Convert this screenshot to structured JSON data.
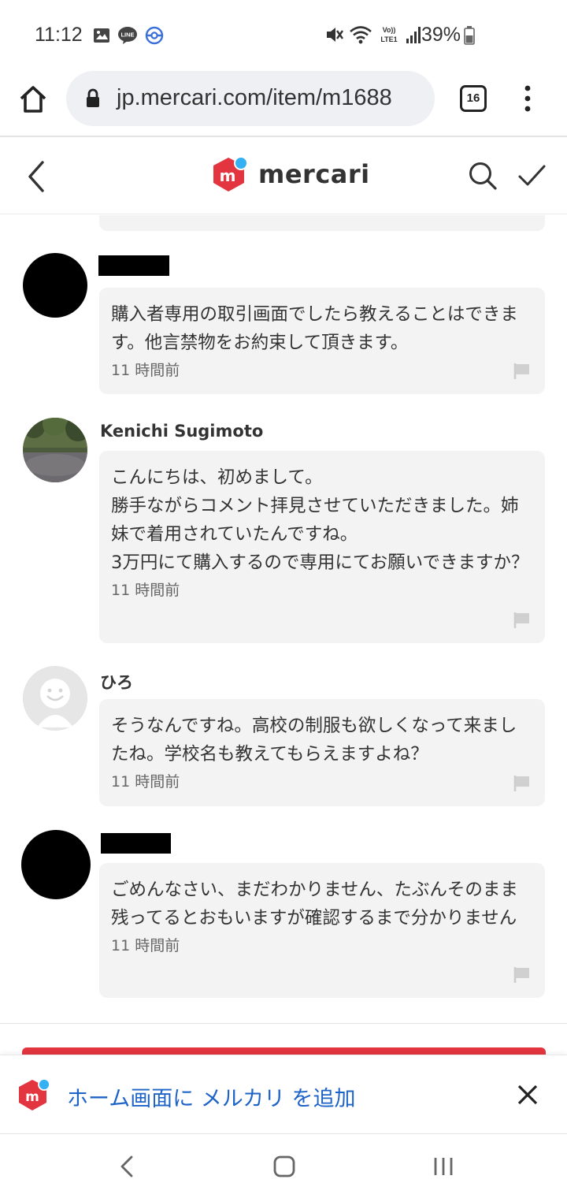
{
  "status_bar": {
    "time": "11:12",
    "battery": "39%",
    "left_icons": [
      "gallery-icon",
      "line-app-icon",
      "pokemon-go-icon"
    ],
    "right_icons": [
      "mute-icon",
      "wifi-icon",
      "volte-lte-icon",
      "signal-icon",
      "battery-icon"
    ],
    "volte_label": "Vo))\nLTE1"
  },
  "browser": {
    "url": "jp.mercari.com/item/m1688",
    "tab_count": "16"
  },
  "header": {
    "logo_text": "mercari",
    "brand_color": "#e3353f",
    "logo_dot_color": "#35b0f2"
  },
  "comments": [
    {
      "name": "",
      "name_redacted": true,
      "avatar": "redacted-black",
      "text": "購入者専用の取引画面でしたら教えることはできます。他言禁物をお約束して頂きます。",
      "time": "11 時間前"
    },
    {
      "name": "Kenichi Sugimoto",
      "name_redacted": false,
      "avatar": "photo-park",
      "text": "こんにちは、初めまして。\n勝手ながらコメント拝見させていただきました。姉妹で着用されていたんですね。\n3万円にて購入するので専用にてお願いできますか？",
      "time": "11 時間前"
    },
    {
      "name": "ひろ",
      "name_redacted": false,
      "avatar": "default-smiley",
      "text": "そうなんですね。高校の制服も欲しくなって来ましたね。学校名も教えてもらえますよね？",
      "time": "11 時間前"
    },
    {
      "name": "",
      "name_redacted": true,
      "avatar": "redacted-black",
      "text": "ごめんなさい、まだわかりません、たぶんそのまま残ってるとおもいますが確認するまで分かりません",
      "time": "11 時間前"
    }
  ],
  "add_to_home": {
    "text": "ホーム画面に メルカリ を追加"
  },
  "nav": {
    "back": "back-icon",
    "home": "home-icon",
    "recent": "recent-apps-icon"
  }
}
